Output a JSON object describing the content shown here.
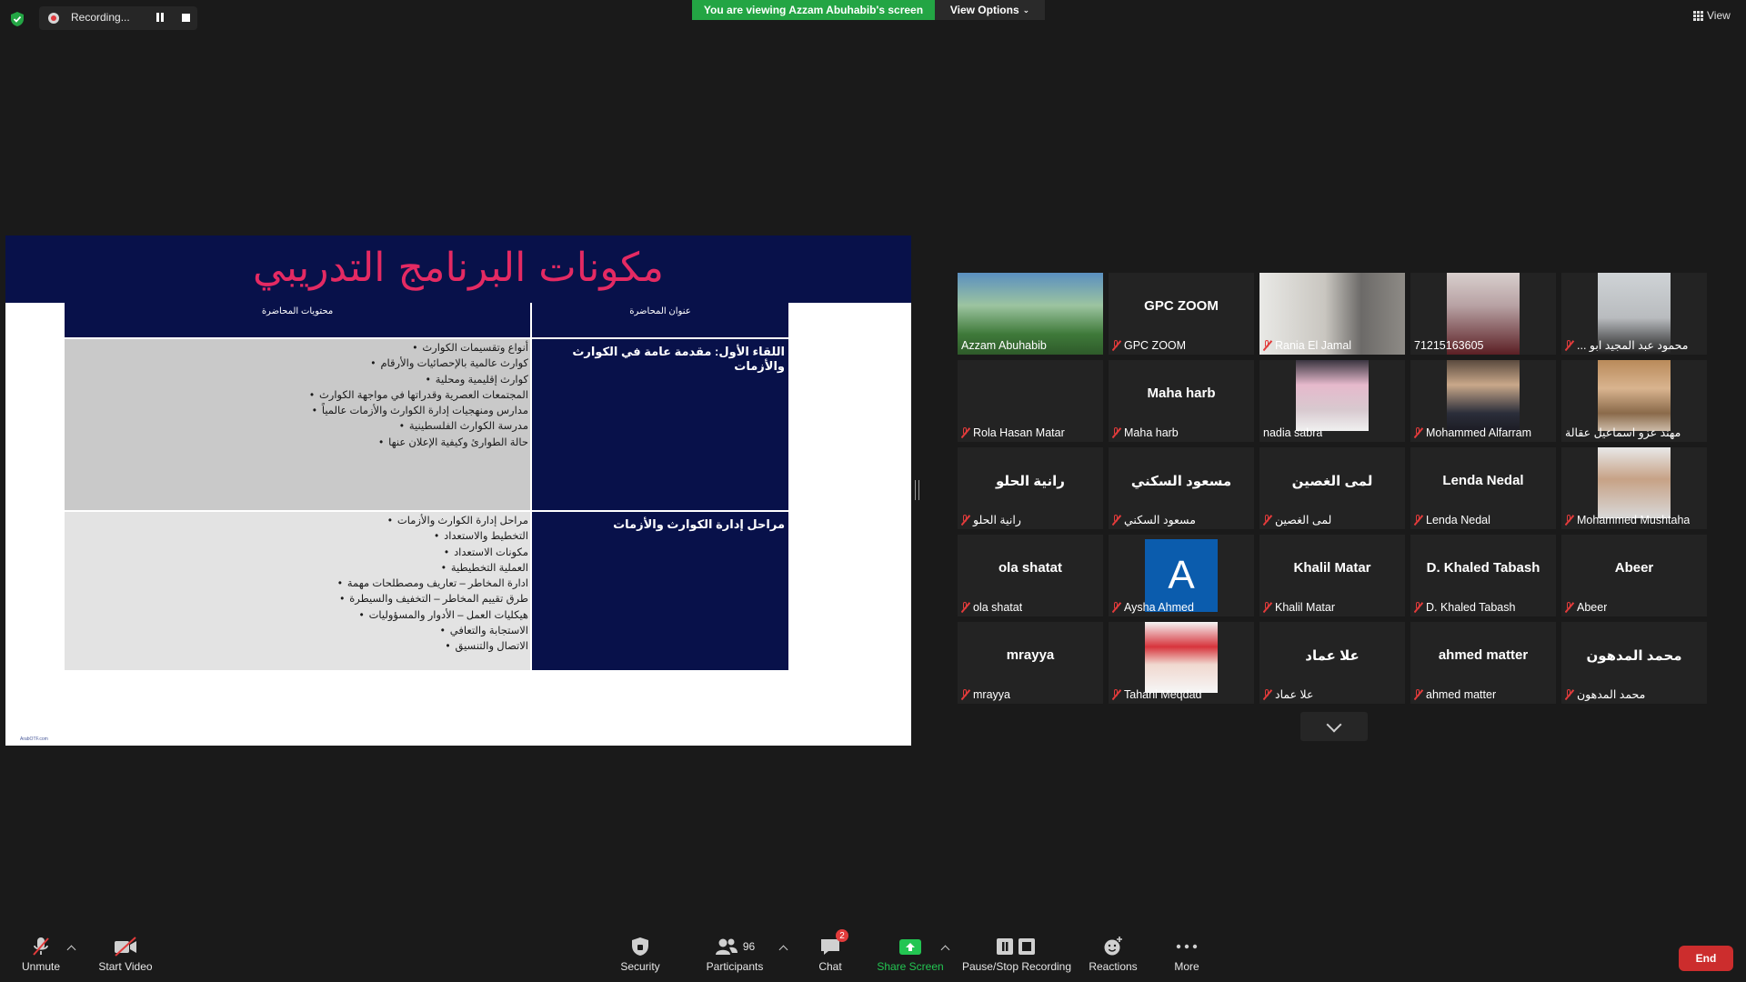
{
  "topbar": {
    "recording_label": "Recording...",
    "viewing_banner": "You are viewing Azzam Abuhabib's screen",
    "view_options_label": "View Options",
    "view_label": "View"
  },
  "slide": {
    "title": "مكونات البرنامج التدريبي",
    "header_left": "محتويات المحاضرة",
    "header_right": "عنوان المحاضرة",
    "rows": [
      {
        "title": "اللقاء الأول: مقدمة عامة في الكوارث والأزمات",
        "items": [
          "أنواع وتقسيمات الكوارث",
          "كوارث عالمية بالإحصائيات والأرقام",
          "كوارث إقليمية ومحلية",
          "المجتمعات العصرية وقدراتها في مواجهة الكوارث",
          "مدارس ومنهجيات إدارة الكوارث والأزمات عالمياً",
          "مدرسة الكوارث الفلسطينية",
          "حالة الطوارئ وكيفية الإعلان عنها"
        ]
      },
      {
        "title": "مراحل إدارة الكوارث والأزمات",
        "items": [
          "مراحل إدارة الكوارث والأزمات",
          "التخطيط والاستعداد",
          "مكونات الاستعداد",
          "العملية التخطيطية",
          "ادارة المخاطر – تعاريف ومصطلحات مهمة",
          "طرق تقييم المخاطر – التخفيف والسيطرة",
          "هيكليات العمل – الأدوار والمسؤوليات",
          "الاستجابة والتعافي",
          "الاتصال والتنسيق"
        ]
      }
    ],
    "footer": "ArabOTF.com"
  },
  "participants": [
    {
      "name": "Azzam Abuhabib",
      "center": "",
      "muted": false,
      "video": "green",
      "active": true
    },
    {
      "name": "GPC ZOOM",
      "center": "GPC ZOOM",
      "muted": true,
      "video": "",
      "active": false
    },
    {
      "name": "Rania El Jamal",
      "center": "",
      "muted": true,
      "video": "room",
      "active": false
    },
    {
      "name": "71215163605",
      "center": "",
      "muted": false,
      "video": "pink",
      "active": false
    },
    {
      "name": "... محمود عبد المجيد ابو",
      "center": "",
      "muted": true,
      "video": "face",
      "active": false
    },
    {
      "name": "Rola Hasan Matar",
      "center": "",
      "muted": true,
      "video": "",
      "active": false
    },
    {
      "name": "Maha harb",
      "center": "Maha harb",
      "muted": true,
      "video": "",
      "active": false
    },
    {
      "name": "nadia sabra",
      "center": "",
      "muted": false,
      "video": "hijab",
      "active": false
    },
    {
      "name": "Mohammed Alfarram",
      "center": "",
      "muted": true,
      "video": "man",
      "active": false
    },
    {
      "name": "مهند عزو اسماعيل عقالة",
      "center": "",
      "muted": false,
      "video": "man2",
      "active": false
    },
    {
      "name": "رانية الحلو",
      "center": "رانية الحلو",
      "muted": true,
      "video": "",
      "active": false
    },
    {
      "name": "مسعود السكني",
      "center": "مسعود السكني",
      "muted": true,
      "video": "",
      "active": false
    },
    {
      "name": "لمى الغصين",
      "center": "لمى الغصين",
      "muted": true,
      "video": "",
      "active": false
    },
    {
      "name": "Lenda Nedal",
      "center": "Lenda Nedal",
      "muted": true,
      "video": "",
      "active": false
    },
    {
      "name": "Mohammed Mushtaha",
      "center": "",
      "muted": true,
      "video": "man3",
      "active": false
    },
    {
      "name": "ola shatat",
      "center": "ola shatat",
      "muted": true,
      "video": "",
      "active": false
    },
    {
      "name": "Aysha Ahmed",
      "center": "",
      "muted": true,
      "video": "initial",
      "initial": "A",
      "active": false
    },
    {
      "name": "Khalil Matar",
      "center": "Khalil Matar",
      "muted": true,
      "video": "",
      "active": false
    },
    {
      "name": "D. Khaled Tabash",
      "center": "D. Khaled Tabash",
      "muted": true,
      "video": "",
      "active": false
    },
    {
      "name": "Abeer",
      "center": "Abeer",
      "muted": true,
      "video": "",
      "active": false
    },
    {
      "name": "mrayya",
      "center": "mrayya",
      "muted": true,
      "video": "",
      "active": false
    },
    {
      "name": "Tahani Meqdad",
      "center": "",
      "muted": true,
      "video": "redscarf",
      "active": false
    },
    {
      "name": "علا عماد",
      "center": "علا عماد",
      "muted": true,
      "video": "",
      "active": false
    },
    {
      "name": "ahmed matter",
      "center": "ahmed matter",
      "muted": true,
      "video": "",
      "active": false
    },
    {
      "name": "محمد المدهون",
      "center": "محمد المدهون",
      "muted": true,
      "video": "",
      "active": false
    }
  ],
  "toolbar": {
    "unmute": "Unmute",
    "start_video": "Start Video",
    "security": "Security",
    "participants": "Participants",
    "participants_count": "96",
    "chat": "Chat",
    "chat_badge": "2",
    "share_screen": "Share Screen",
    "pause_stop_recording": "Pause/Stop Recording",
    "reactions": "Reactions",
    "more": "More",
    "end": "End"
  },
  "colors": {
    "background": "#1a1a1a",
    "banner_green": "#23a544",
    "slide_navy": "#08114a",
    "slide_title_pink": "#e42a63",
    "active_speaker_border": "#d3e36a",
    "end_red": "#cc2d2d",
    "share_green": "#23c552"
  }
}
